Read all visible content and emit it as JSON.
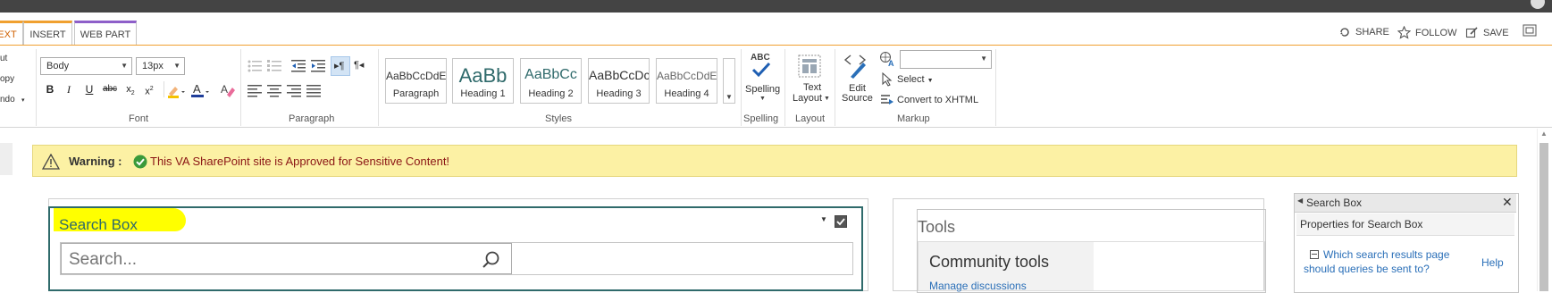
{
  "tabs": {
    "text_partial": "EXT",
    "insert": "INSERT",
    "web_part": "WEB PART"
  },
  "top_actions": {
    "share": "SHARE",
    "follow": "FOLLOW",
    "save": "SAVE"
  },
  "clipboard": {
    "cut": "ut",
    "copy": "opy",
    "undo": "ndo"
  },
  "font": {
    "style_value": "Body",
    "size_value": "13px",
    "group_label": "Font"
  },
  "paragraph": {
    "group_label": "Paragraph"
  },
  "styles": {
    "group_label": "Styles",
    "items": [
      {
        "sample": "AaBbCcDdE",
        "name": "Paragraph"
      },
      {
        "sample": "AaBb",
        "name": "Heading 1"
      },
      {
        "sample": "AaBbCc",
        "name": "Heading 2"
      },
      {
        "sample": "AaBbCcDc",
        "name": "Heading 3"
      },
      {
        "sample": "AaBbCcDdE",
        "name": "Heading 4"
      }
    ]
  },
  "spelling": {
    "abc": "ABC",
    "label": "Spelling",
    "group_label": "Spelling"
  },
  "layout": {
    "label_line1": "Text",
    "label_line2": "Layout",
    "group_label": "Layout"
  },
  "markup": {
    "edit_line1": "Edit",
    "edit_line2": "Source",
    "select": "Select",
    "convert": "Convert to XHTML",
    "group_label": "Markup",
    "dropdown_value": ""
  },
  "warning": {
    "label": "Warning :",
    "message": "This VA SharePoint site is Approved for Sensitive Content!"
  },
  "search_webpart": {
    "title": "Search Box",
    "placeholder": "Search..."
  },
  "tools_webpart": {
    "title": "Tools",
    "heading": "Community tools",
    "link": "Manage discussions"
  },
  "tool_pane": {
    "title": "Search Box",
    "subtitle": "Properties for Search Box",
    "question": "Which search results page should queries be sent to?",
    "help": "Help"
  },
  "colors": {
    "orange_tab": "#f0a030",
    "purple_tab": "#8e5fc9",
    "warning_bg": "#fcf1a4",
    "warning_text": "#8a1414",
    "highlight": "#ffff00",
    "link": "#2a6fb8",
    "webpart_border": "#2f6a6b"
  }
}
